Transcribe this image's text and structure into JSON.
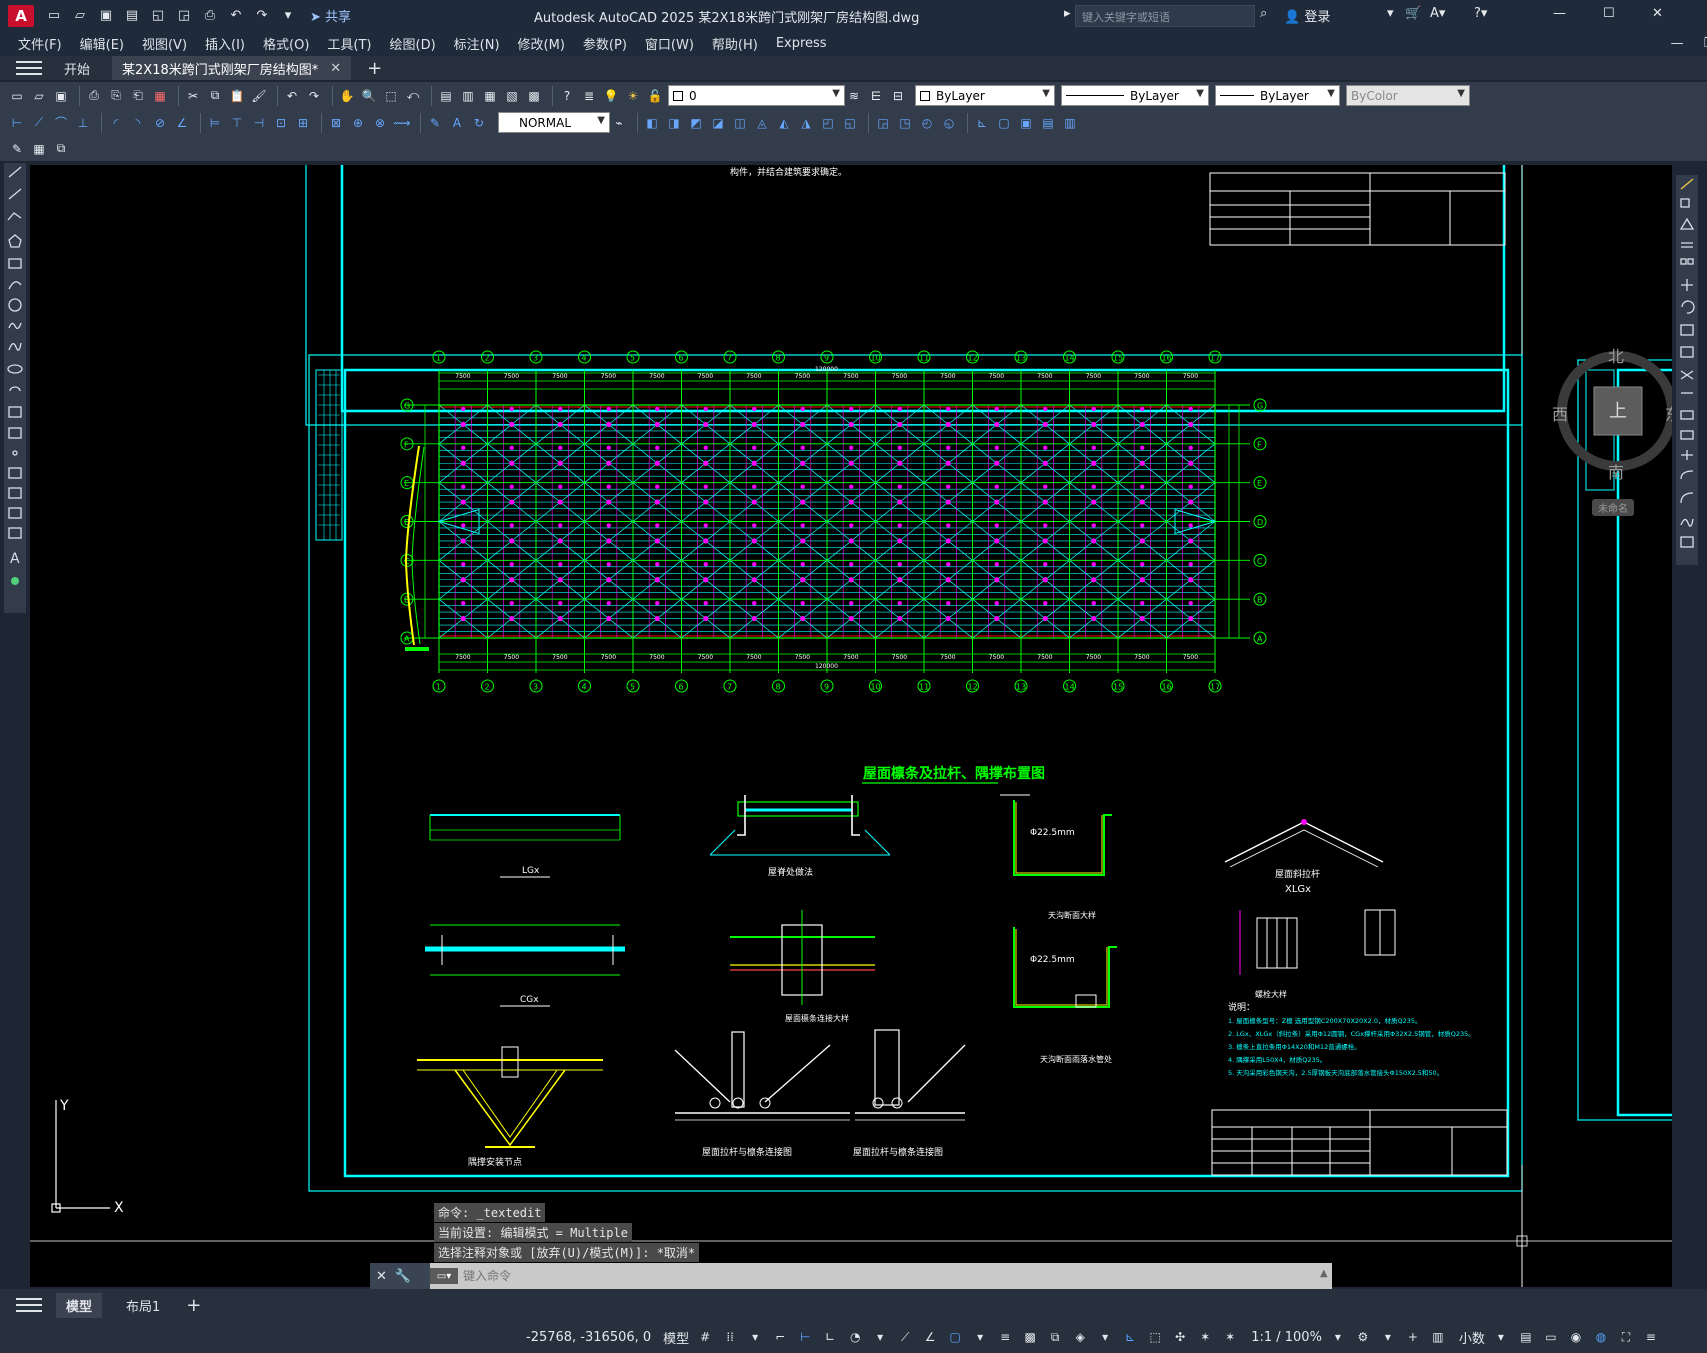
{
  "app": {
    "logo_letter": "A",
    "window_title": "Autodesk AutoCAD 2025    某2X18米跨门式刚架厂房结构图.dwg",
    "share_label": "共享",
    "search_placeholder": "键入关键字或短语",
    "login_label": "登录"
  },
  "menu": [
    "文件(F)",
    "编辑(E)",
    "视图(V)",
    "插入(I)",
    "格式(O)",
    "工具(T)",
    "绘图(D)",
    "标注(N)",
    "修改(M)",
    "参数(P)",
    "窗口(W)",
    "帮助(H)",
    "Express"
  ],
  "tabs": {
    "start": "开始",
    "doc": "某2X18米跨门式刚架厂房结构图*"
  },
  "toolbar": {
    "layer_value": "0",
    "color_value": "ByLayer",
    "linetype_value": "ByLayer",
    "lineweight_value": "ByLayer",
    "plotstyle_value": "ByColor",
    "dimstyle_value": "NORMAL"
  },
  "viewcube": {
    "north": "北",
    "south": "南",
    "east": "东",
    "west": "西",
    "top": "上",
    "wcs_label": "未命名"
  },
  "drawing": {
    "note_top": "构件，并结合建筑要求确定。",
    "plan_title": "屋面檩条及拉杆、隅撑布置图",
    "axis_numbers": [
      "1",
      "2",
      "3",
      "4",
      "5",
      "6",
      "7",
      "8",
      "9",
      "10",
      "11",
      "12",
      "13",
      "14",
      "15",
      "16",
      "17"
    ],
    "axis_letters": [
      "G",
      "F",
      "E",
      "D",
      "C",
      "B",
      "A"
    ],
    "bay_dim": "7500",
    "total_dim": "120000",
    "detail_labels": [
      "LGx",
      "CGx",
      "屋脊处做法",
      "屋面檩条连接大样",
      "隅撑安装节点",
      "屋面拉杆与檩条连接图",
      "屋面拉杆与檩条连接图",
      "天沟断面大样",
      "天沟断面雨落水管处",
      "屋面斜拉杆",
      "XLGx",
      "螺栓大样"
    ],
    "notes_title": "说明：",
    "notes": [
      "1. 屋面檩条型号：Z檩 选用型钢C200X70X20X2.0，材质Q235。",
      "2. LGx、XLGx（斜拉条）采用Φ12圆钢，CGx撑杆采用Φ32X2.5钢管，材质Q235。",
      "3. 檩条上直拉条用Φ14X20和M12普通螺栓。",
      "4. 隅撑采用L50X4，材质Q235。",
      "5. 天沟采用彩色钢天沟，2.5厚钢板天沟底部落水管接头Φ150X2.5和50。"
    ],
    "pipe_dim": "Φ22.5mm"
  },
  "commands": {
    "line1": "命令: _textedit",
    "line2": "当前设置: 编辑模式 = Multiple",
    "line3": "选择注释对象或 [放弃(U)/模式(M)]: *取消*",
    "input_placeholder": "键入命令"
  },
  "layouts": [
    "模型",
    "布局1"
  ],
  "status": {
    "coords": "-25768, -316506, 0",
    "space": "模型",
    "scale": "1:1 / 100%",
    "units": "小数"
  },
  "colors": {
    "cyan": "#00ffff",
    "green": "#00ff00",
    "magenta": "#ff00ff",
    "yellow": "#ffff00",
    "red": "#ff0000",
    "white": "#ffffff"
  }
}
